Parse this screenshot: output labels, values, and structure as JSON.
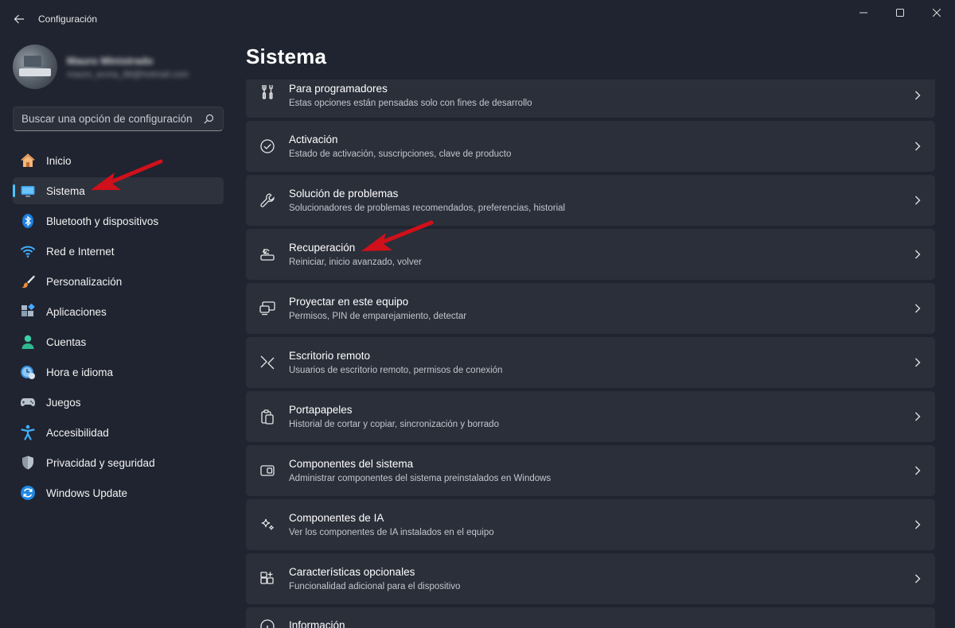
{
  "window": {
    "title": "Configuración"
  },
  "profile": {
    "name": "Mauro Ministrado",
    "email": "mauro_ecma_88@hotmail.com"
  },
  "search": {
    "placeholder": "Buscar una opción de configuración"
  },
  "sidebar": {
    "items": [
      {
        "label": "Inicio",
        "icon": "home-icon"
      },
      {
        "label": "Sistema",
        "icon": "monitor-icon",
        "active": true
      },
      {
        "label": "Bluetooth y dispositivos",
        "icon": "bluetooth-icon"
      },
      {
        "label": "Red e Internet",
        "icon": "wifi-icon"
      },
      {
        "label": "Personalización",
        "icon": "brush-icon"
      },
      {
        "label": "Aplicaciones",
        "icon": "apps-icon"
      },
      {
        "label": "Cuentas",
        "icon": "person-icon"
      },
      {
        "label": "Hora e idioma",
        "icon": "clock-globe-icon"
      },
      {
        "label": "Juegos",
        "icon": "gamepad-icon"
      },
      {
        "label": "Accesibilidad",
        "icon": "accessibility-icon"
      },
      {
        "label": "Privacidad y seguridad",
        "icon": "shield-icon"
      },
      {
        "label": "Windows Update",
        "icon": "update-icon"
      }
    ]
  },
  "main": {
    "title": "Sistema",
    "cards": [
      {
        "title": "Para programadores",
        "subtitle": "Estas opciones están pensadas solo con fines de desarrollo",
        "icon": "developer-tools-icon"
      },
      {
        "title": "Activación",
        "subtitle": "Estado de activación, suscripciones, clave de producto",
        "icon": "check-circle-icon"
      },
      {
        "title": "Solución de problemas",
        "subtitle": "Solucionadores de problemas recomendados, preferencias, historial",
        "icon": "wrench-icon"
      },
      {
        "title": "Recuperación",
        "subtitle": "Reiniciar, inicio avanzado, volver",
        "icon": "recovery-icon"
      },
      {
        "title": "Proyectar en este equipo",
        "subtitle": "Permisos, PIN de emparejamiento, detectar",
        "icon": "project-icon"
      },
      {
        "title": "Escritorio remoto",
        "subtitle": "Usuarios de escritorio remoto, permisos de conexión",
        "icon": "remote-desktop-icon"
      },
      {
        "title": "Portapapeles",
        "subtitle": "Historial de cortar y copiar, sincronización y borrado",
        "icon": "clipboard-icon"
      },
      {
        "title": "Componentes del sistema",
        "subtitle": "Administrar componentes del sistema preinstalados en Windows",
        "icon": "system-components-icon"
      },
      {
        "title": "Componentes de IA",
        "subtitle": "Ver los componentes de IA instalados en el equipo",
        "icon": "sparkle-icon"
      },
      {
        "title": "Características opcionales",
        "subtitle": "Funcionalidad adicional para el dispositivo",
        "icon": "add-features-icon"
      },
      {
        "title": "Información",
        "subtitle": "",
        "icon": "info-icon"
      }
    ]
  },
  "colors": {
    "background": "#202430",
    "card": "#2b2f3a",
    "accent": "#4cc2ff",
    "annotation_arrow": "#d0101a"
  }
}
